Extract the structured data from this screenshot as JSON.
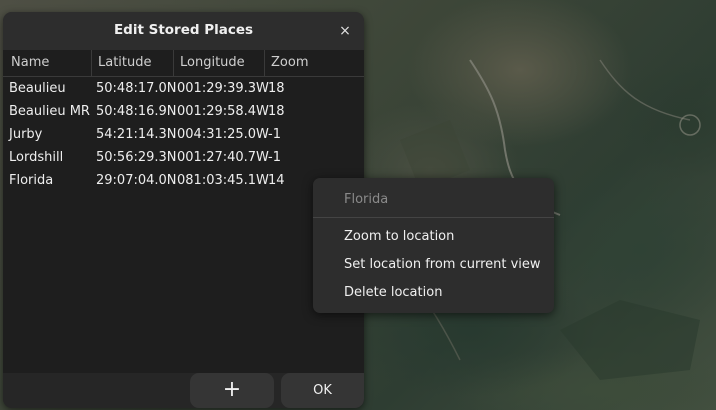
{
  "dialog": {
    "title": "Edit Stored Places",
    "close_glyph": "×",
    "columns": [
      "Name",
      "Latitude",
      "Longitude",
      "Zoom"
    ],
    "rows": [
      {
        "name": "Beaulieu",
        "lat": "50:48:17.0N",
        "lon": "001:29:39.3W",
        "zoom": "18"
      },
      {
        "name": "Beaulieu MR",
        "lat": "50:48:16.9N",
        "lon": "001:29:58.4W",
        "zoom": "18"
      },
      {
        "name": "Jurby",
        "lat": "54:21:14.3N",
        "lon": "004:31:25.0W",
        "zoom": "-1"
      },
      {
        "name": "Lordshill",
        "lat": "50:56:29.3N",
        "lon": "001:27:40.7W",
        "zoom": "-1"
      },
      {
        "name": "Florida",
        "lat": "29:07:04.0N",
        "lon": "081:03:45.1W",
        "zoom": "14"
      }
    ],
    "add_glyph": "+",
    "ok_label": "OK"
  },
  "context_menu": {
    "header": "Florida",
    "items": [
      "Zoom to location",
      "Set location from current view",
      "Delete location"
    ]
  },
  "icons": {
    "close": "close-icon",
    "add": "plus-icon"
  }
}
